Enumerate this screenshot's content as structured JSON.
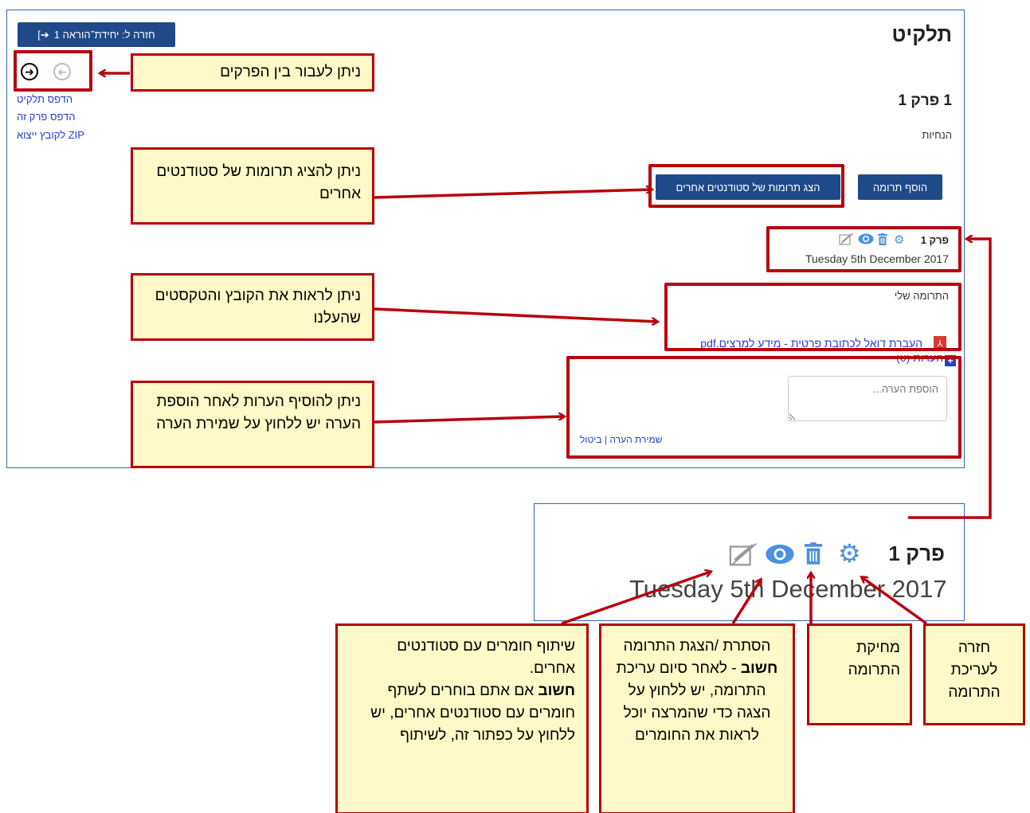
{
  "app": {
    "page_title": "תלקיט",
    "back_button": "חזרה ל: יחידת־הוראה 1",
    "chapter_title": "1 פרק 1",
    "instructions_label": "הנחיות",
    "side_links": [
      "הדפס תלקיט",
      "הדפס פרק זה",
      "ZIP לקובץ ייצוא"
    ],
    "add_contribution_button": "הוסף תרומה",
    "show_others_button": "הצג תרומות של סטודנטים אחרים",
    "entry": {
      "title": "פרק 1",
      "date": "Tuesday 5th December 2017"
    },
    "my_contribution_label": "התרומה שלי",
    "file_link": "העברת דואל לכתובת פרטית - מידע למרצים.pdf",
    "comments_label": "הערות (0)",
    "comment_placeholder": "הוספת הערה...",
    "save_comment_link": "שמירת הערה",
    "separator": "|",
    "cancel_link": "ביטול"
  },
  "zoom": {
    "title": "פרק 1",
    "date": "Tuesday 5th December 2017"
  },
  "callouts": {
    "navigate": "ניתן לעבור בין הפרקים",
    "show_others": "ניתן להציג תרומות של סטודנטים אחרים",
    "see_file": "ניתן לראות את הקובץ והטקסטים שהעלנו",
    "add_comments": "ניתן להוסיף הערות לאחר הוספת הערה יש ללחוץ על שמירת הערה",
    "edit": "חזרה לעריכת התרומה",
    "delete": "מחיקת התרומה",
    "hide_show_title": "הסתרת /הצגת התרומה",
    "hide_show_bold": "חשוב",
    "hide_show_rest": " - לאחר סיום עריכת התרומה, יש ללחוץ על הצגה כדי שהמרצה יוכל לראות את החומרים",
    "share_title": "שיתוף חומרים עם סטודנטים אחרים.",
    "share_bold": "חשוב",
    "share_rest": "  אם אתם בוחרים לשתף חומרים עם סטודנטים אחרים, יש ללחוץ על כפתור זה, לשיתוף"
  },
  "colors": {
    "annotation_red": "#b8000d",
    "callout_fill": "#fff9c9",
    "button_blue": "#1e4a8a",
    "icon_blue": "#4a90e2",
    "link_blue": "#2540c6"
  },
  "icons": [
    "arrow-right-circle-icon",
    "arrow-left-circle-icon",
    "gear-icon",
    "trash-icon",
    "eye-icon",
    "share-icon",
    "pdf-icon",
    "plus-icon",
    "login-icon"
  ]
}
